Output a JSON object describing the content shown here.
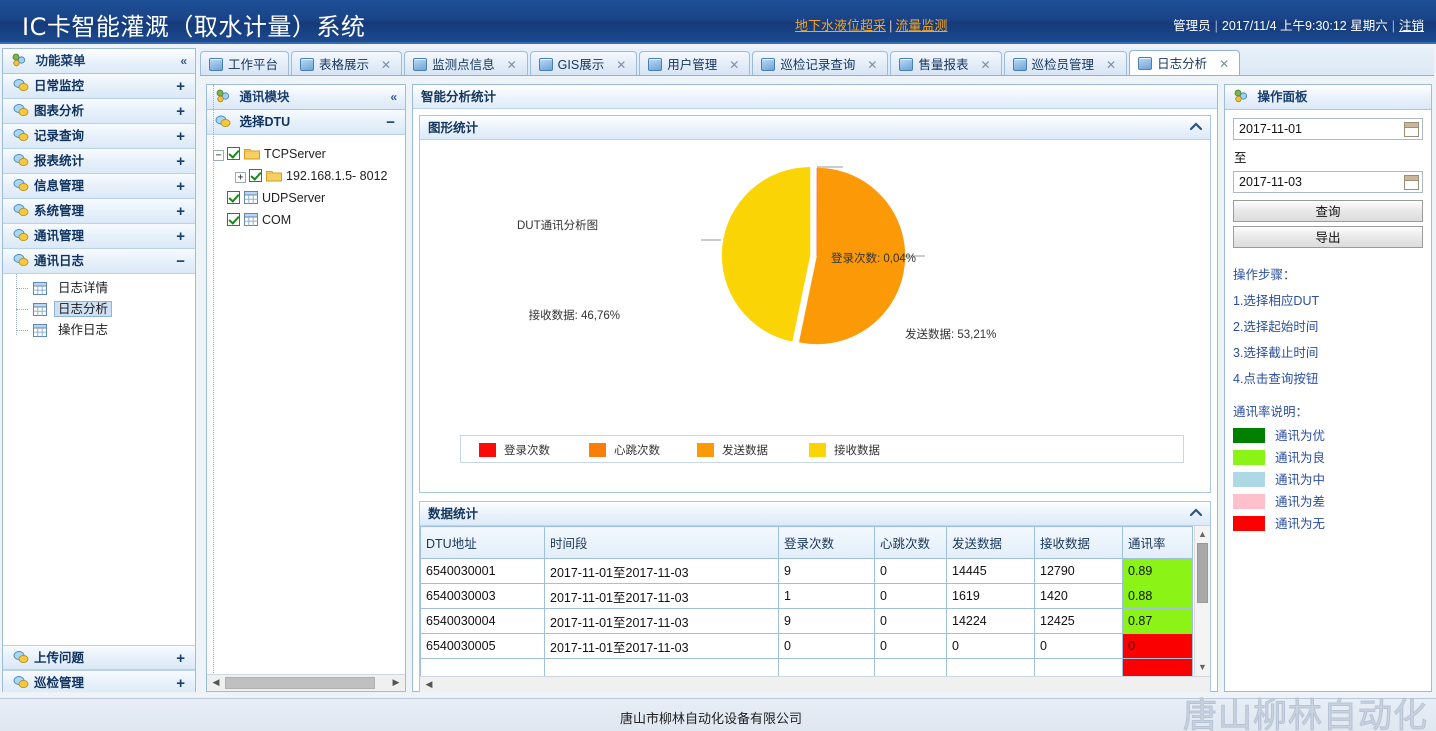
{
  "header": {
    "title": "IC卡智能灌溉（取水计量）系统",
    "link1": "地下水液位超采",
    "link_sep": "|",
    "link2": "流量监测",
    "user": "管理员",
    "sep1": "|",
    "datetime": "2017/11/4 上午9:30:12  星期六",
    "sep2": "|",
    "logout": "注销"
  },
  "sidebar": {
    "title": "功能菜单",
    "collapse_icon": "«",
    "groups": [
      {
        "label": "日常监控",
        "state": "+"
      },
      {
        "label": "图表分析",
        "state": "+"
      },
      {
        "label": "记录查询",
        "state": "+"
      },
      {
        "label": "报表统计",
        "state": "+"
      },
      {
        "label": "信息管理",
        "state": "+"
      },
      {
        "label": "系统管理",
        "state": "+"
      },
      {
        "label": "通讯管理",
        "state": "+"
      },
      {
        "label": "通讯日志",
        "state": "−"
      }
    ],
    "sub_items": [
      {
        "label": "日志详情",
        "selected": false
      },
      {
        "label": "日志分析",
        "selected": true
      },
      {
        "label": "操作日志",
        "selected": false
      }
    ],
    "bottom_groups": [
      {
        "label": "上传问题",
        "state": "+"
      },
      {
        "label": "巡检管理",
        "state": "+"
      }
    ]
  },
  "tabs": [
    {
      "label": "工作平台",
      "closable": false,
      "active": false
    },
    {
      "label": "表格展示",
      "closable": true,
      "active": false
    },
    {
      "label": "监测点信息",
      "closable": true,
      "active": false
    },
    {
      "label": "GIS展示",
      "closable": true,
      "active": false
    },
    {
      "label": "用户管理",
      "closable": true,
      "active": false
    },
    {
      "label": "巡检记录查询",
      "closable": true,
      "active": false
    },
    {
      "label": "售量报表",
      "closable": true,
      "active": false
    },
    {
      "label": "巡检员管理",
      "closable": true,
      "active": false
    },
    {
      "label": "日志分析",
      "closable": true,
      "active": true
    }
  ],
  "tab_close_glyph": "✕",
  "comm_panel": {
    "title": "通讯模块",
    "collapse_icon": "«",
    "section_title": "选择DTU",
    "section_state": "−",
    "tree": [
      {
        "level": 1,
        "expander": "−",
        "checked": true,
        "icon": "folder-icon",
        "label": "TCPServer"
      },
      {
        "level": 2,
        "expander": "+",
        "checked": true,
        "icon": "folder-icon",
        "label": "192.168.1.5- 8012"
      },
      {
        "level": 1,
        "expander": "",
        "checked": true,
        "icon": "grid-icon",
        "label": "UDPServer"
      },
      {
        "level": 1,
        "expander": "",
        "checked": true,
        "icon": "grid-icon",
        "label": "COM"
      }
    ]
  },
  "main": {
    "title": "智能分析统计",
    "chart_card_title": "图形统计",
    "chart_card_chevron": "︿",
    "table_card_title": "数据统计",
    "table_card_chevron": "︿"
  },
  "chart_data": {
    "type": "pie",
    "title": "DUT通讯分析图",
    "categories": [
      "登录次数",
      "心跳次数",
      "发送数据",
      "接收数据"
    ],
    "values": [
      0.04,
      0,
      53.21,
      46.76
    ],
    "labels": [
      "登录次数: 0,04%",
      "",
      "发送数据: 53,21%",
      "接收数据: 46,76%"
    ],
    "colors": [
      "#FB0C06",
      "#FA7D09",
      "#FB9A06",
      "#FBD406"
    ],
    "legend": [
      "登录次数",
      "心跳次数",
      "发送数据",
      "接收数据"
    ],
    "legend_position": "bottom",
    "exploded": true
  },
  "table": {
    "columns": [
      "DTU地址",
      "时间段",
      "登录次数",
      "心跳次数",
      "发送数据",
      "接收数据",
      "通讯率"
    ],
    "rows": [
      {
        "cells": [
          "6540030001",
          "2017-11-01至2017-11-03",
          "9",
          "0",
          "14445",
          "12790",
          "0.89"
        ],
        "rate_color": "#8CF316"
      },
      {
        "cells": [
          "6540030003",
          "2017-11-01至2017-11-03",
          "1",
          "0",
          "1619",
          "1420",
          "0.88"
        ],
        "rate_color": "#8CF316"
      },
      {
        "cells": [
          "6540030004",
          "2017-11-01至2017-11-03",
          "9",
          "0",
          "14224",
          "12425",
          "0.87"
        ],
        "rate_color": "#8CF316"
      },
      {
        "cells": [
          "6540030005",
          "2017-11-01至2017-11-03",
          "0",
          "0",
          "0",
          "0",
          "0"
        ],
        "rate_color": "#FB0000"
      }
    ]
  },
  "right_panel": {
    "title": "操作面板",
    "start_date": "2017-11-01",
    "between_label": "至",
    "end_date": "2017-11-03",
    "query_button": "查询",
    "export_button": "导出",
    "steps_title": "操作步骤：",
    "steps": [
      "1.选择相应DUT",
      "2.选择起始时间",
      "3.选择截止时间",
      "4.点击查询按钮"
    ],
    "rate_legend_title": "通讯率说明：",
    "rate_legend": [
      {
        "label": "通讯为优",
        "color": "#008000"
      },
      {
        "label": "通讯为良",
        "color": "#8CF316"
      },
      {
        "label": "通讯为中",
        "color": "#ADD8E6"
      },
      {
        "label": "通讯为差",
        "color": "#FFC0CB"
      },
      {
        "label": "通讯为无",
        "color": "#FB0000"
      }
    ]
  },
  "footer": {
    "company": "唐山市柳林自动化设备有限公司",
    "watermark": "唐山柳林自动化"
  }
}
